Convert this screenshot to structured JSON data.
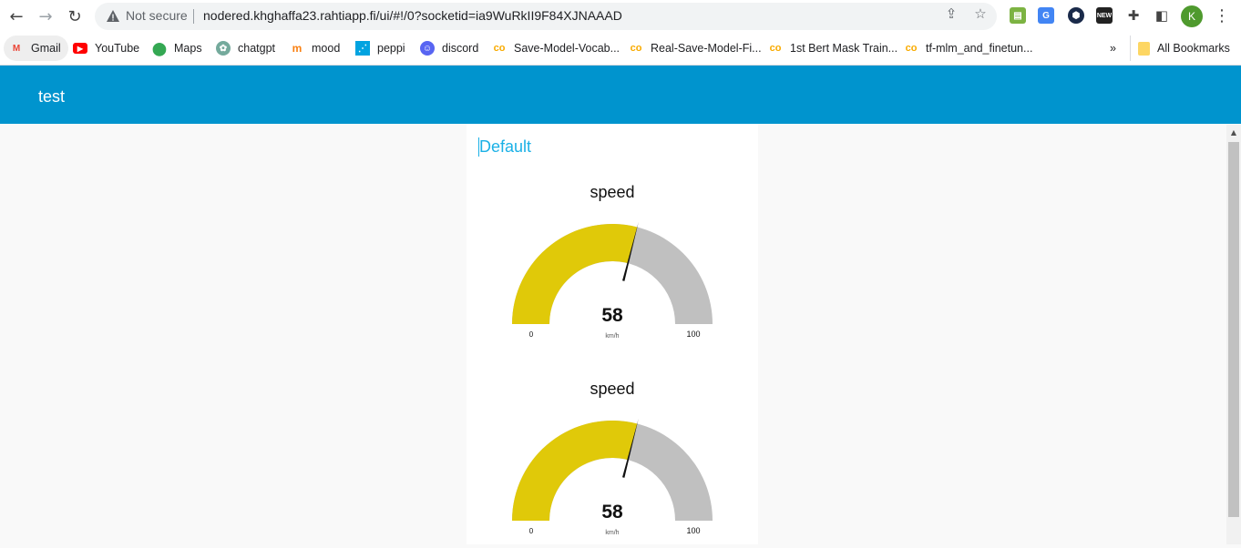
{
  "browser": {
    "security_label": "Not secure",
    "url": "nodered.khghaffa23.rahtiapp.fi/ui/#!/0?socketid=ia9WuRkII9F84XJNAAAD",
    "profile_initial": "K",
    "bookmarks": [
      {
        "label": "Gmail",
        "icon": "gmail-icon"
      },
      {
        "label": "YouTube",
        "icon": "youtube-icon"
      },
      {
        "label": "Maps",
        "icon": "maps-icon"
      },
      {
        "label": "chatgpt",
        "icon": "chatgpt-icon"
      },
      {
        "label": "mood",
        "icon": "moodle-icon"
      },
      {
        "label": "peppi",
        "icon": "peppi-icon"
      },
      {
        "label": "discord",
        "icon": "discord-icon"
      },
      {
        "label": "Save-Model-Vocab...",
        "icon": "colab-icon"
      },
      {
        "label": "Real-Save-Model-Fi...",
        "icon": "colab-icon"
      },
      {
        "label": "1st Bert Mask Train...",
        "icon": "colab-icon"
      },
      {
        "label": "tf-mlm_and_finetun...",
        "icon": "colab-icon"
      }
    ],
    "overflow_label": "»",
    "all_bookmarks_label": "All Bookmarks"
  },
  "app": {
    "title": "test",
    "group_title": "Default",
    "colors": {
      "header": "#0094ce",
      "group_title": "#1bb1e6",
      "gauge_fill": "#e0c909",
      "gauge_track": "#c0c0c0"
    }
  },
  "gauges": [
    {
      "title": "speed",
      "value": "58",
      "unit": "km/h",
      "min": "0",
      "max": "100",
      "fraction": 0.58
    },
    {
      "title": "speed",
      "value": "58",
      "unit": "km/h",
      "min": "0",
      "max": "100",
      "fraction": 0.58
    }
  ]
}
